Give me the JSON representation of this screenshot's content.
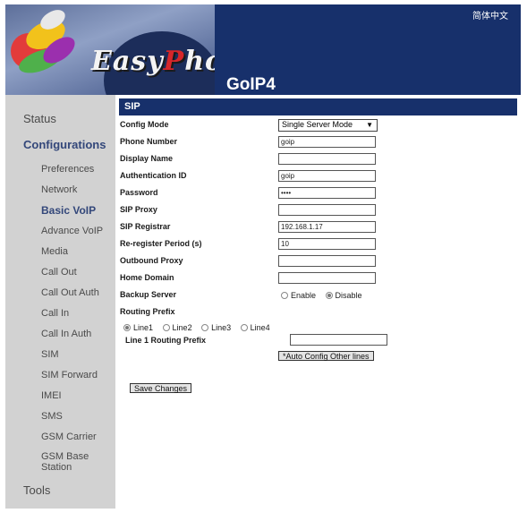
{
  "header": {
    "logo_text_1": "Easy",
    "logo_text_p": "P",
    "logo_text_2": "hone",
    "product": "GoIP4",
    "lang_link": "简体中文"
  },
  "sidebar": {
    "status": "Status",
    "configurations": "Configurations",
    "items": [
      "Preferences",
      "Network",
      "Basic VoIP",
      "Advance VoIP",
      "Media",
      "Call Out",
      "Call Out Auth",
      "Call In",
      "Call In Auth",
      "SIM",
      "SIM Forward",
      "IMEI",
      "SMS",
      "GSM Carrier"
    ],
    "gsm_base_1": "GSM Base",
    "gsm_base_2": "Station",
    "tools": "Tools"
  },
  "section": {
    "title": "SIP"
  },
  "form": {
    "config_mode_label": "Config Mode",
    "config_mode_value": "Single Server Mode",
    "phone_number_label": "Phone Number",
    "phone_number_value": "goip",
    "display_name_label": "Display Name",
    "display_name_value": "",
    "auth_id_label": "Authentication ID",
    "auth_id_value": "goip",
    "password_label": "Password",
    "password_value": "••••",
    "sip_proxy_label": "SIP Proxy",
    "sip_proxy_value": "",
    "sip_registrar_label": "SIP Registrar",
    "sip_registrar_value": "192.168.1.17",
    "reregister_label": "Re-register Period (s)",
    "reregister_value": "10",
    "outbound_proxy_label": "Outbound Proxy",
    "outbound_proxy_value": "",
    "home_domain_label": "Home Domain",
    "home_domain_value": "",
    "backup_server_label": "Backup Server",
    "backup_enable": "Enable",
    "backup_disable": "Disable",
    "backup_selected": "Disable",
    "routing_prefix_label": "Routing Prefix",
    "lines": [
      "Line1",
      "Line2",
      "Line3",
      "Line4"
    ],
    "line_selected": "Line1",
    "line1_prefix_label": "Line 1 Routing Prefix",
    "line1_prefix_value": "",
    "auto_config_button": "*Auto Config Other lines",
    "save_button": "Save Changes"
  }
}
